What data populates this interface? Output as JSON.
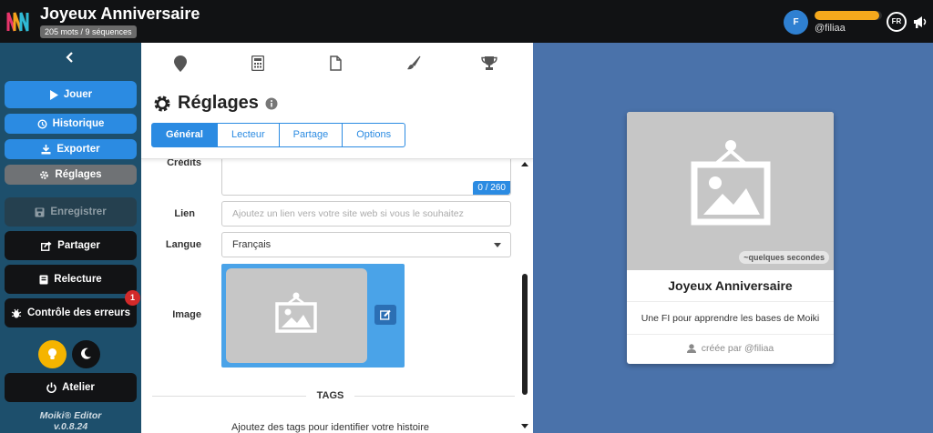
{
  "header": {
    "title": "Joyeux Anniversaire",
    "stats": "205 mots / 9 séquences",
    "user": {
      "avatar_letter": "F",
      "username": "@filiaa",
      "progress_fraction": 0.96
    },
    "language": "FR",
    "icons": [
      "app-logo-icon",
      "megaphone-icon"
    ],
    "colors": {
      "accent": "#2b8be2",
      "progress": "#f5a81c"
    }
  },
  "sidebar": {
    "play": "Jouer",
    "history": "Historique",
    "export": "Exporter",
    "settings": "Réglages",
    "save": "Enregistrer",
    "share": "Partager",
    "review": "Relecture",
    "errors": "Contrôle des erreurs",
    "errors_count": "1",
    "atelier": "Atelier",
    "version_name": "Moiki® Editor",
    "version_number": "v.0.8.24"
  },
  "settings": {
    "title": "Réglages",
    "tabs": [
      "Général",
      "Lecteur",
      "Partage",
      "Options"
    ],
    "active_tab": "Général",
    "credits_label": "Crédits",
    "credits_count": "0 / 260",
    "link_label": "Lien",
    "link_placeholder": "Ajoutez un lien vers votre site web si vous le souhaitez",
    "language_label": "Langue",
    "language_value": "Français",
    "image_label": "Image",
    "tags_title": "TAGS",
    "tags_hint": "Ajoutez des tags pour identifier votre histoire"
  },
  "preview": {
    "time": "~quelques secondes",
    "title": "Joyeux Anniversaire",
    "description": "Une FI pour apprendre les bases de Moiki",
    "author": "créée par @filiaa"
  }
}
